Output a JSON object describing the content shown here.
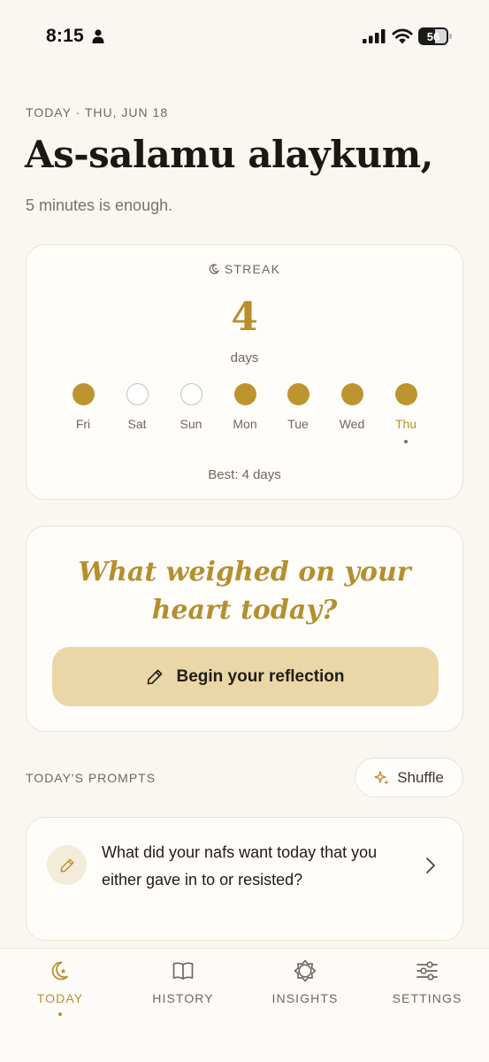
{
  "status_bar": {
    "time": "8:15",
    "battery": "56"
  },
  "header": {
    "date_line": "TODAY · THU, JUN 18",
    "greeting": "As-salamu alaykum,",
    "subtitle": "5 minutes is enough."
  },
  "streak": {
    "label": "STREAK",
    "count": "4",
    "unit": "days",
    "days": [
      {
        "name": "Fri",
        "done": true
      },
      {
        "name": "Sat",
        "done": false
      },
      {
        "name": "Sun",
        "done": false
      },
      {
        "name": "Mon",
        "done": true
      },
      {
        "name": "Tue",
        "done": true
      },
      {
        "name": "Wed",
        "done": true
      },
      {
        "name": "Thu",
        "done": true,
        "today": true
      }
    ],
    "best": "Best: 4 days"
  },
  "reflection": {
    "question_line1": "What weighed on your",
    "question_line2": "heart today?",
    "button_label": "Begin your reflection"
  },
  "prompts": {
    "header": "TODAY'S PROMPTS",
    "shuffle_label": "Shuffle",
    "items": [
      {
        "text": "What did your nafs want today that you either gave in to or resisted?"
      }
    ]
  },
  "nav": {
    "items": [
      {
        "label": "TODAY",
        "icon": "crescent-star-icon",
        "active": true
      },
      {
        "label": "HISTORY",
        "icon": "book-icon",
        "active": false
      },
      {
        "label": "INSIGHTS",
        "icon": "star-badge-icon",
        "active": false
      },
      {
        "label": "SETTINGS",
        "icon": "sliders-icon",
        "active": false
      }
    ]
  },
  "colors": {
    "accent": "#b98f2c",
    "button": "#ead6a6",
    "background": "#faf7f2"
  }
}
